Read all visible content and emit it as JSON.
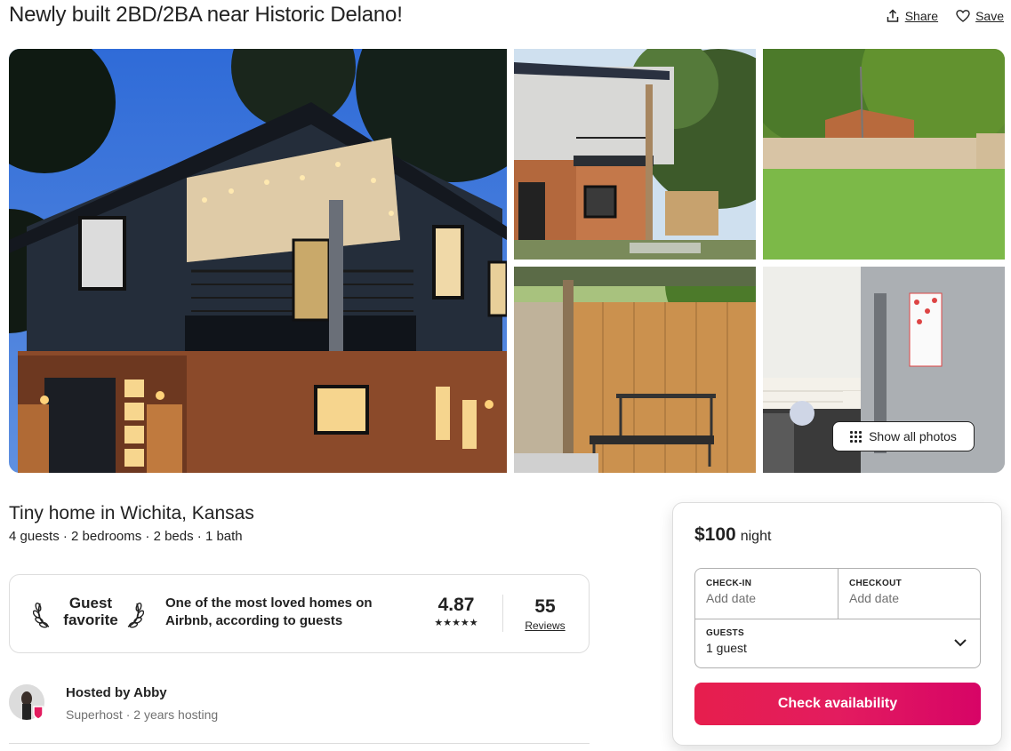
{
  "listing": {
    "title": "Newly built 2BD/2BA near Historic Delano!",
    "share_label": "Share",
    "save_label": "Save",
    "show_all_photos_label": "Show all photos",
    "subtitle": "Tiny home in Wichita, Kansas",
    "details": "4 guests · 2 bedrooms · 2 beds · 1 bath"
  },
  "guest_favorite": {
    "badge_line1": "Guest",
    "badge_line2": "favorite",
    "description": "One of the most loved homes on Airbnb, according to guests",
    "rating": "4.87",
    "stars": "★★★★★",
    "review_count": "55",
    "reviews_label": "Reviews"
  },
  "host": {
    "hosted_by": "Hosted by Abby",
    "meta": "Superhost · 2 years hosting"
  },
  "booking": {
    "price": "$100",
    "unit": "night",
    "checkin_label": "CHECK-IN",
    "checkin_value": "Add date",
    "checkout_label": "CHECKOUT",
    "checkout_value": "Add date",
    "guests_label": "GUESTS",
    "guests_value": "1 guest",
    "cta_label": "Check availability"
  },
  "icons": {
    "share": "share-icon",
    "save": "heart-icon",
    "show_all": "grid-icon",
    "laurel": "laurel-icon",
    "chevron": "chevron-down-icon"
  },
  "colors": {
    "brand": "#e31c5f",
    "text": "#222222",
    "muted": "#717171",
    "border": "#dddddd"
  }
}
